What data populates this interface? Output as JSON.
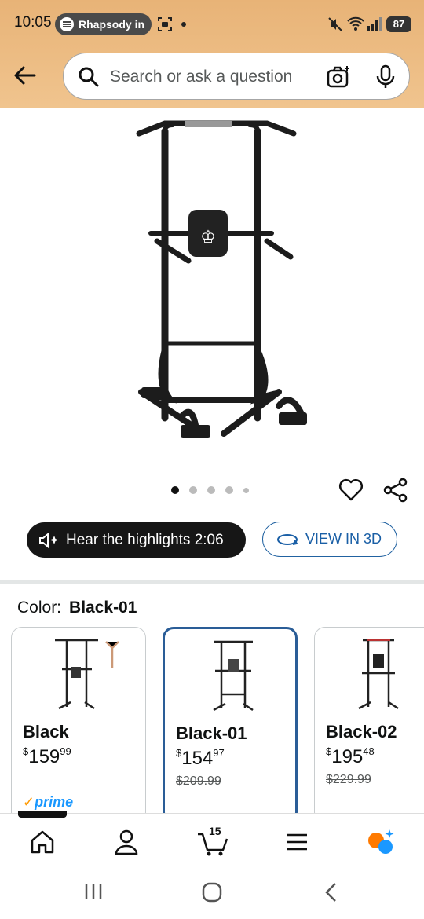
{
  "status_bar": {
    "time": "10:05",
    "app_pill": "Rhapsody in",
    "battery": "87"
  },
  "search": {
    "placeholder": "Search or ask a question"
  },
  "carousel": {
    "page_count": 5,
    "current_page": 1
  },
  "actions": {
    "hear_label": "Hear the highlights 2:06",
    "view3d_label": "VIEW IN 3D"
  },
  "color": {
    "label": "Color:",
    "selected": "Black-01"
  },
  "variants": [
    {
      "name": "Black",
      "price_whole": "159",
      "price_fraction": "99",
      "currency": "$",
      "was": "",
      "prime": true
    },
    {
      "name": "Black-01",
      "price_whole": "154",
      "price_fraction": "97",
      "currency": "$",
      "was": "$209.99",
      "prime": false
    },
    {
      "name": "Black-02",
      "price_whole": "195",
      "price_fraction": "48",
      "currency": "$",
      "was": "$229.99",
      "prime": false
    }
  ],
  "prime_label": {
    "check": "✓",
    "word": "prime"
  },
  "bottom_nav": {
    "cart_count": "15"
  },
  "colors": {
    "header_bg": "#f0c48e",
    "link_blue": "#2162a1",
    "selected_border": "#2a5d97"
  }
}
